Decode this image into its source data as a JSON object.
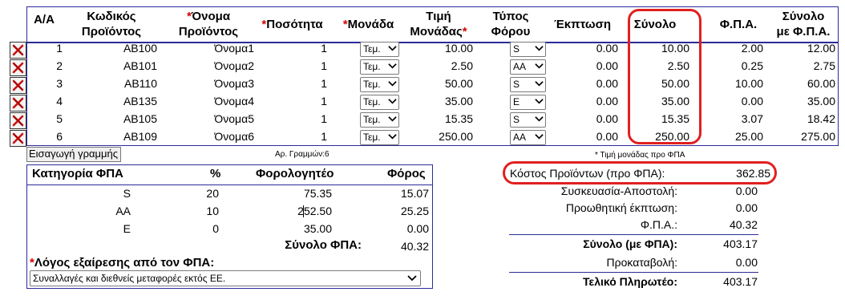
{
  "grid": {
    "headers": {
      "aa": "Α/Α",
      "code_1": "Κωδικός",
      "code_2": "Προϊόντος",
      "name_1": "Όνομα",
      "name_2": "Προϊόντος",
      "qty": "Ποσότητα",
      "unit": "Μονάδα",
      "price_1": "Τιμή",
      "price_2": "Μονάδας",
      "taxtype_1": "Τύπος",
      "taxtype_2": "Φόρου",
      "discount": "Έκπτωση",
      "total": "Σύνολο",
      "vat": "Φ.Π.Α.",
      "total_vat_1": "Σύνολο",
      "total_vat_2": "με Φ.Π.Α.",
      "required_mark": "*"
    },
    "rows": [
      {
        "aa": "1",
        "code": "AB100",
        "name": "Όνομα1",
        "qty": "1",
        "unit": "Τεμ.",
        "price": "10.00",
        "taxtype": "S",
        "discount": "0.00",
        "total": "10.00",
        "vat": "2.00",
        "total_vat": "12.00"
      },
      {
        "aa": "2",
        "code": "AB101",
        "name": "Όνομα2",
        "qty": "1",
        "unit": "Τεμ.",
        "price": "2.50",
        "taxtype": "AA",
        "discount": "0.00",
        "total": "2.50",
        "vat": "0.25",
        "total_vat": "2.75"
      },
      {
        "aa": "3",
        "code": "AB110",
        "name": "Όνομα3",
        "qty": "1",
        "unit": "Τεμ.",
        "price": "50.00",
        "taxtype": "S",
        "discount": "0.00",
        "total": "50.00",
        "vat": "10.00",
        "total_vat": "60.00"
      },
      {
        "aa": "4",
        "code": "AB135",
        "name": "Όνομα4",
        "qty": "1",
        "unit": "Τεμ.",
        "price": "35.00",
        "taxtype": "E",
        "discount": "0.00",
        "total": "35.00",
        "vat": "0.00",
        "total_vat": "35.00"
      },
      {
        "aa": "5",
        "code": "AB105",
        "name": "Όνομα5",
        "qty": "1",
        "unit": "Τεμ.",
        "price": "15.35",
        "taxtype": "S",
        "discount": "0.00",
        "total": "15.35",
        "vat": "3.07",
        "total_vat": "18.42"
      },
      {
        "aa": "6",
        "code": "AB109",
        "name": "Όνομα6",
        "qty": "1",
        "unit": "Τεμ.",
        "price": "250.00",
        "taxtype": "AA",
        "discount": "0.00",
        "total": "250.00",
        "vat": "25.00",
        "total_vat": "275.00"
      }
    ],
    "add_row_label": "Εισαγωγή γραμμής",
    "row_count_label": "Αρ. Γραμμών:6",
    "price_note": "* Τιμή μονάδας προ ΦΠΑ"
  },
  "vat_table": {
    "headers": {
      "category": "Κατηγορία ΦΠΑ",
      "percent": "%",
      "taxable": "Φορολογητέο",
      "tax": "Φόρος"
    },
    "rows": [
      {
        "category": "S",
        "percent": "20",
        "taxable": "75.35",
        "tax": "15.07"
      },
      {
        "category": "AA",
        "percent": "10",
        "taxable": "252.50",
        "tax": "25.25"
      },
      {
        "category": "E",
        "percent": "0",
        "taxable": "35.00",
        "tax": "0.00"
      }
    ],
    "total_label": "Σύνολο ΦΠΑ:",
    "total_value": "40.32",
    "reason_label": "Λόγος εξαίρεσης από τον ΦΠΑ:",
    "reason_value": "Συναλλαγές και διεθνείς μεταφορές εκτός ΕΕ."
  },
  "summary": {
    "product_cost_label": "Κόστος Προϊόντων (προ ΦΠΑ):",
    "product_cost_value": "362.85",
    "packaging_label": "Συσκευασία-Αποστολή:",
    "packaging_value": "0.00",
    "promo_label": "Προωθητική έκπτωση:",
    "promo_value": "0.00",
    "vat_label": "Φ.Π.Α.:",
    "vat_value": "40.32",
    "total_label": "Σύνολο (με ΦΠΑ):",
    "total_value": "403.17",
    "deposit_label": "Προκαταβολή:",
    "deposit_value": "0.00",
    "final_label": "Τελικό Πληρωτέο:",
    "final_value": "403.17"
  },
  "colors": {
    "border": "#2b2b9a",
    "required": "#d40000",
    "highlight": "#e02020",
    "delete_x": "#cc1111"
  },
  "icons": {
    "delete": "red-x-delete-icon",
    "dropdown": "chevron-down-icon"
  }
}
